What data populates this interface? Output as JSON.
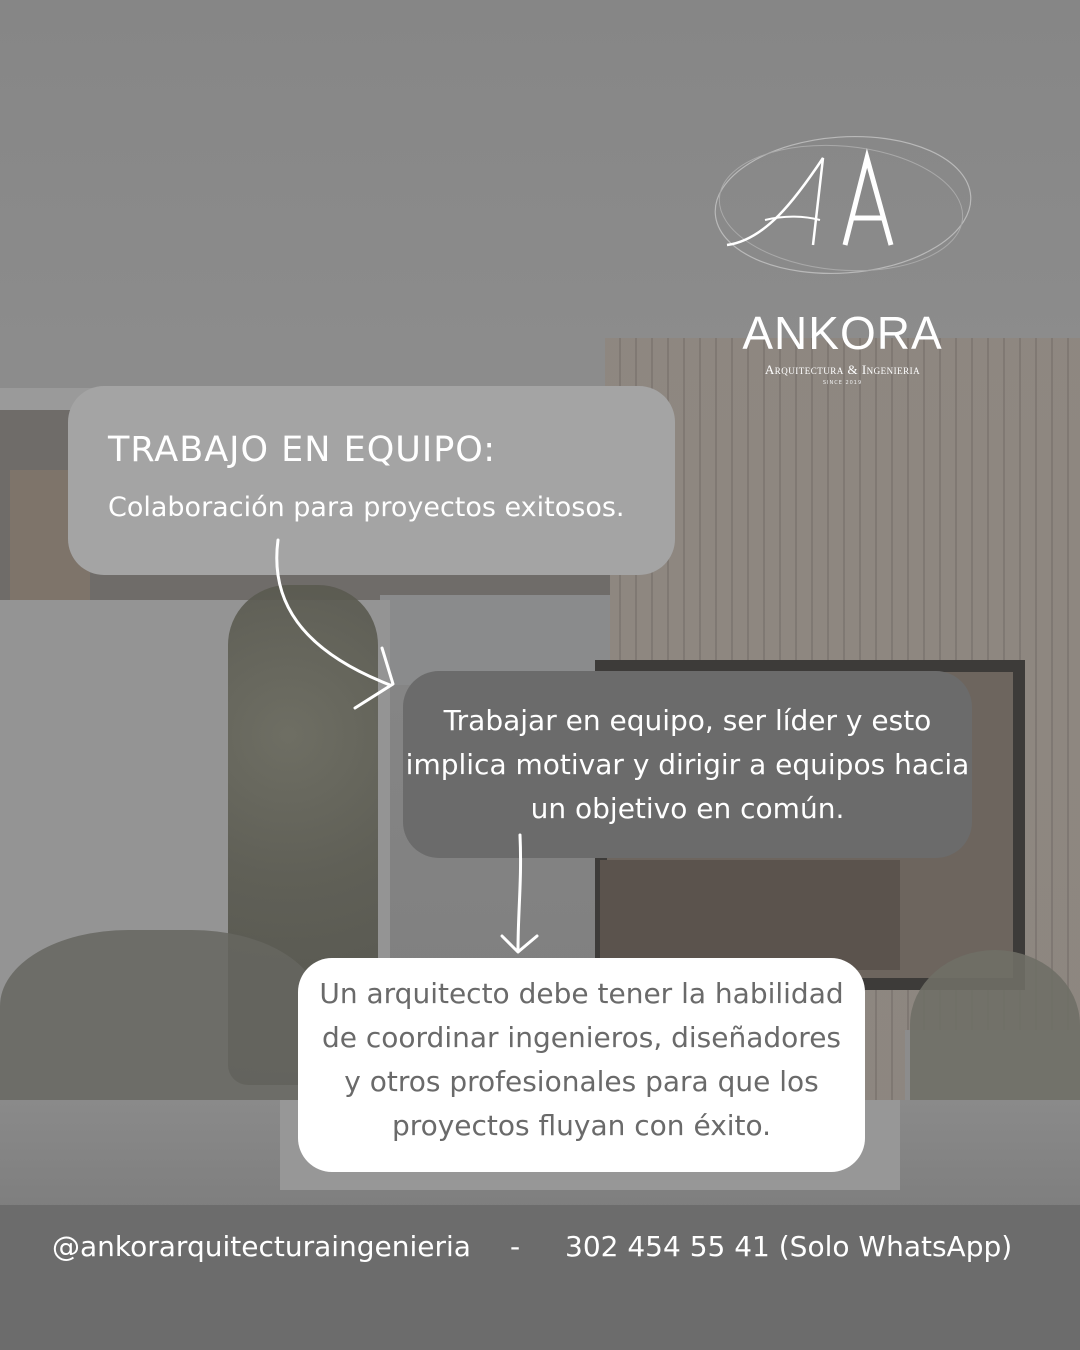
{
  "brand": {
    "monogram": "AA",
    "name": "ANKORA",
    "tagline": "Arquitectura & Ingenieria",
    "since": "SINCE 2019"
  },
  "card1": {
    "title": "TRABAJO EN EQUIPO:",
    "subtitle": "Colaboración para proyectos exitosos."
  },
  "card2": {
    "lines": [
      "Trabajar en equipo, ser líder y esto",
      "implica motivar y dirigir a equipos hacia",
      "un objetivo en común."
    ]
  },
  "card3": {
    "lines": [
      "Un arquitecto debe tener la habilidad",
      "de coordinar ingenieros, diseñadores",
      "y otros profesionales para que los",
      "proyectos fluyan con éxito."
    ]
  },
  "footer": {
    "handle": "@ankorarquitecturaingenieria",
    "separator": "-",
    "phone": "302 454 55 41 (Solo WhatsApp)"
  },
  "colors": {
    "card1_bg": "#a4a4a4",
    "card2_bg": "#6b6b6b",
    "card3_bg": "#ffffff",
    "card3_text": "#6a6a6a",
    "text_light": "#ffffff"
  }
}
